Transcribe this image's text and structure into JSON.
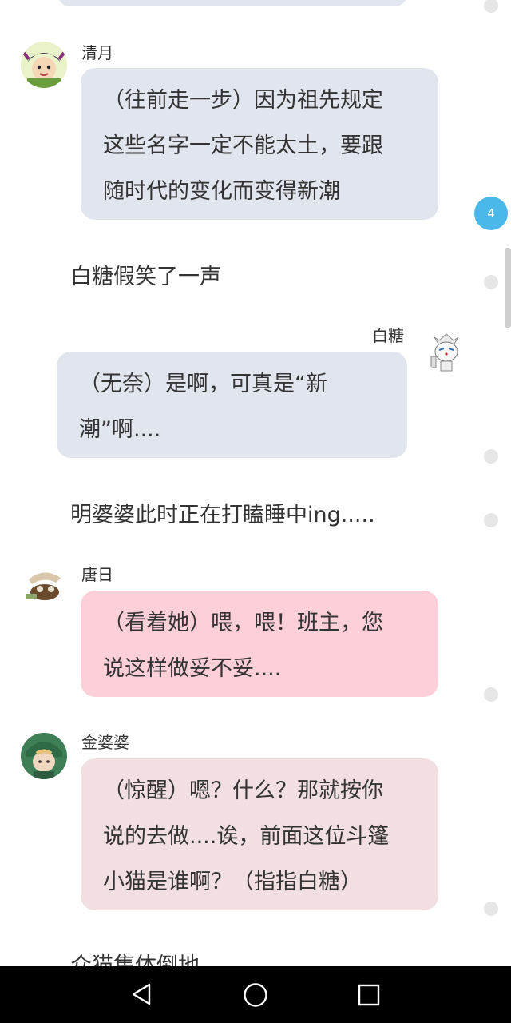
{
  "badge": {
    "count": "4"
  },
  "messages": [
    {
      "speaker": "清月",
      "text": "（往前走一步）因为祖先规定\n这些名字一定不能太土，要跟\n随时代的变化而变得新潮"
    },
    {
      "speaker": "白糖",
      "text": "（无奈）是啊，可真是“新\n潮”啊...."
    },
    {
      "speaker": "唐日",
      "text": "（看着她）喂，喂！班主，您\n说这样做妥不妥...."
    },
    {
      "speaker": "金婆婆",
      "text": "（惊醒）嗯？什么？那就按你\n说的去做....诶，前面这位斗篷\n小猫是谁啊？（指指白糖）"
    }
  ],
  "narration": [
    "白糖假笑了一声",
    "明婆婆此时正在打瞌睡中ing.....",
    "众猫集体倒地"
  ],
  "colors": {
    "bubble_gray": "#e1e6ee",
    "bubble_pink": "#fdcfd9",
    "bubble_rose": "#f1dfe1",
    "badge_blue": "#4bb8ea"
  },
  "navbar": {
    "back": "back-icon",
    "home": "home-icon",
    "recents": "recents-icon"
  }
}
